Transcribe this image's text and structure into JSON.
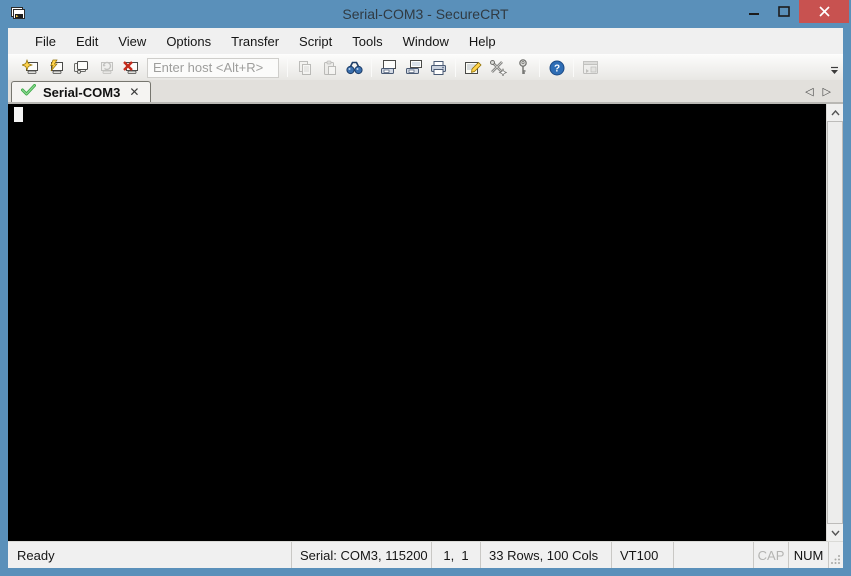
{
  "window": {
    "title": "Serial-COM3 - SecureCRT"
  },
  "menu": {
    "items": [
      "File",
      "Edit",
      "View",
      "Options",
      "Transfer",
      "Script",
      "Tools",
      "Window",
      "Help"
    ]
  },
  "toolbar": {
    "host_placeholder": "Enter host <Alt+R>"
  },
  "tabbar": {
    "active_tab": {
      "label": "Serial-COM3"
    },
    "close_glyph": "✕",
    "scroll_left_glyph": "◁",
    "scroll_right_glyph": "▷"
  },
  "statusbar": {
    "ready": "Ready",
    "serial": "Serial: COM3, 115200",
    "cursor_position": "1,  1",
    "terminal_size": "33 Rows, 100 Cols",
    "emulation": "VT100",
    "caps_lock": "CAP",
    "num_lock": "NUM"
  },
  "colors": {
    "titlebar": "#5a90ba",
    "close_button": "#c85250",
    "terminal_bg": "#000000",
    "tab_check_green": "#3fae49",
    "help_blue": "#2e6db5",
    "accent_yellow": "#ffd34d",
    "disconnect_red": "#c42b1c"
  }
}
